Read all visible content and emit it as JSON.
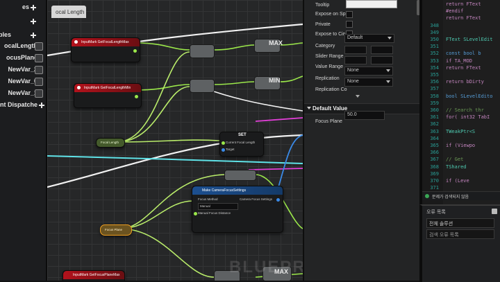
{
  "left_panel": {
    "items": [
      {
        "label": "es"
      },
      {
        "label": "bles"
      },
      {
        "label": "ocalLength"
      },
      {
        "label": "ocusPlane"
      },
      {
        "label": "NewVar_2"
      },
      {
        "label": "NewVar_0"
      },
      {
        "label": "NewVar_1"
      },
      {
        "label": "nt Dispatche"
      }
    ]
  },
  "graph": {
    "tab_label": "ocal Length",
    "watermark": "BLUEPRINT",
    "nodes": {
      "get_focal_max": "InputMark GetFocalLengthMax",
      "get_focal_min": "InputMark GetFocalLengthMin",
      "focal_length_var": "Focal Length",
      "focus_plane_var": "Focus Plane",
      "get_focus_max": "InputMark GetFocusPlaneMax",
      "set_node": "SET",
      "set_pin_a": "Current Focal Length",
      "set_pin_b": "Target",
      "make_struct": "Make CameraFocusSettings",
      "make_struct_pin": "Focus Method",
      "make_struct_pin2": "Manual Focus Distance",
      "make_struct_out": "Camera Focus Settings",
      "manual_value": "Manual",
      "max_label_top": "MAX",
      "min_label": "MIN",
      "max_label_bottom": "MAX"
    }
  },
  "details": {
    "props": {
      "tooltip": "Tooltip",
      "expose_spawn": "Expose on Sp",
      "private": "Private",
      "expose_cinematics": "Expose to Cin",
      "category": "Category",
      "category_value": "Default",
      "slider_range": "Slider Range",
      "value_range": "Value Range",
      "replication": "Replication",
      "replication_value": "None",
      "replication_condition": "Replication Co",
      "replication_condition_value": "None"
    },
    "default_value_section": "Default Value",
    "focus_plane_label": "Focus Plane",
    "focus_plane_value": "50.0"
  },
  "code": {
    "lines": [
      {
        "num": "",
        "text": "return FText"
      },
      {
        "num": "",
        "text": "#endif"
      },
      {
        "num": "",
        "text": "return FText"
      },
      {
        "num": "348",
        "text": ""
      },
      {
        "num": "349",
        "text": ""
      },
      {
        "num": "350",
        "text": "FText SLevelEdit"
      },
      {
        "num": "351",
        "text": ""
      },
      {
        "num": "352",
        "text": "const bool b"
      },
      {
        "num": "353",
        "text": "if TA_MOD"
      },
      {
        "num": "354",
        "text": "return FText"
      },
      {
        "num": "355",
        "text": ""
      },
      {
        "num": "356",
        "text": "return bDirty"
      },
      {
        "num": "357",
        "text": ""
      },
      {
        "num": "358",
        "text": "bool SLevelEdito"
      },
      {
        "num": "359",
        "text": ""
      },
      {
        "num": "360",
        "text": "// Search thr"
      },
      {
        "num": "361",
        "text": "for( int32 TabI"
      },
      {
        "num": "362",
        "text": ""
      },
      {
        "num": "363",
        "text": "TWeakPtr<S"
      },
      {
        "num": "364",
        "text": ""
      },
      {
        "num": "365",
        "text": "if (Viewpo"
      },
      {
        "num": "366",
        "text": ""
      },
      {
        "num": "367",
        "text": "// Get"
      },
      {
        "num": "368",
        "text": "TShared"
      },
      {
        "num": "369",
        "text": ""
      },
      {
        "num": "370",
        "text": "if (Leve"
      },
      {
        "num": "371",
        "text": ""
      }
    ],
    "status": "문제가 검색되지 않음"
  },
  "bottom_panel": {
    "title": "오류 목록",
    "rows": [
      "전체 솔루션",
      "검색 오류 목록"
    ]
  }
}
